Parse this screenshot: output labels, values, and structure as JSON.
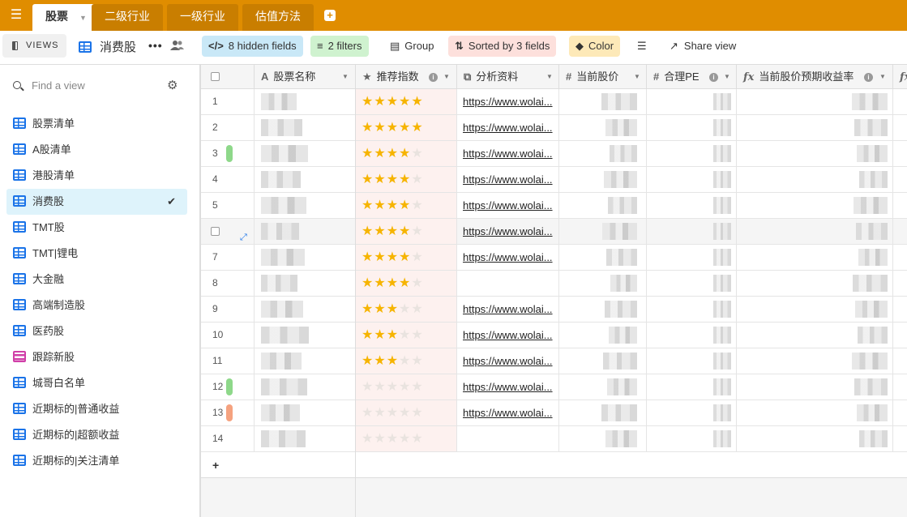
{
  "tabs": [
    {
      "label": "股票",
      "active": true
    },
    {
      "label": "二级行业",
      "active": false
    },
    {
      "label": "一级行业",
      "active": false
    },
    {
      "label": "估值方法",
      "active": false
    }
  ],
  "viewbar": {
    "views_label": "VIEWS",
    "view_name": "消费股",
    "hidden_fields": "8 hidden fields",
    "filters": "2 filters",
    "group": "Group",
    "sorted": "Sorted by 3 fields",
    "color": "Color",
    "share": "Share view",
    "colors": {
      "hidden": "#c9e8f7",
      "filters": "#cff2cf",
      "sorted": "#fde0dc",
      "color": "#fde9b8",
      "topbar": "#e08d00"
    }
  },
  "sidebar": {
    "search_placeholder": "Find a view",
    "items": [
      {
        "label": "股票清单",
        "icon": "grid-icon"
      },
      {
        "label": "A股清单",
        "icon": "grid-icon"
      },
      {
        "label": "港股清单",
        "icon": "grid-icon"
      },
      {
        "label": "消费股",
        "icon": "grid-icon",
        "selected": true
      },
      {
        "label": "TMT股",
        "icon": "grid-icon"
      },
      {
        "label": "TMT|锂电",
        "icon": "grid-icon"
      },
      {
        "label": "大金融",
        "icon": "grid-icon"
      },
      {
        "label": "高端制造股",
        "icon": "grid-icon"
      },
      {
        "label": "医药股",
        "icon": "grid-icon"
      },
      {
        "label": "跟踪新股",
        "icon": "kanban-icon"
      },
      {
        "label": "城哥白名单",
        "icon": "grid-icon"
      },
      {
        "label": "近期标的|普通收益",
        "icon": "grid-icon"
      },
      {
        "label": "近期标的|超额收益",
        "icon": "grid-icon"
      },
      {
        "label": "近期标的|关注清单",
        "icon": "grid-icon"
      }
    ]
  },
  "columns": {
    "name": "股票名称",
    "rating": "推荐指数",
    "link": "分析资料",
    "price": "当前股价",
    "pe": "合理PE",
    "yield": "当前股价预期收益率"
  },
  "rows": [
    {
      "num": "1",
      "stars": 5,
      "link": "https://www.wolai...",
      "color": ""
    },
    {
      "num": "2",
      "stars": 5,
      "link": "https://www.wolai...",
      "color": ""
    },
    {
      "num": "3",
      "stars": 4,
      "link": "https://www.wolai...",
      "color": "#8ed88a"
    },
    {
      "num": "4",
      "stars": 4,
      "link": "https://www.wolai...",
      "color": ""
    },
    {
      "num": "5",
      "stars": 4,
      "link": "https://www.wolai...",
      "color": ""
    },
    {
      "num": "",
      "stars": 4,
      "link": "https://www.wolai...",
      "color": "",
      "hover": true
    },
    {
      "num": "7",
      "stars": 4,
      "link": "https://www.wolai...",
      "color": ""
    },
    {
      "num": "8",
      "stars": 4,
      "link": "",
      "color": ""
    },
    {
      "num": "9",
      "stars": 3,
      "link": "https://www.wolai...",
      "color": ""
    },
    {
      "num": "10",
      "stars": 3,
      "link": "https://www.wolai...",
      "color": ""
    },
    {
      "num": "11",
      "stars": 3,
      "link": "https://www.wolai...",
      "color": ""
    },
    {
      "num": "12",
      "stars": 0,
      "link": "https://www.wolai...",
      "color": "#8ed88a"
    },
    {
      "num": "13",
      "stars": 0,
      "link": "https://www.wolai...",
      "color": "#f5a27f"
    },
    {
      "num": "14",
      "stars": 0,
      "link": "",
      "color": ""
    }
  ]
}
